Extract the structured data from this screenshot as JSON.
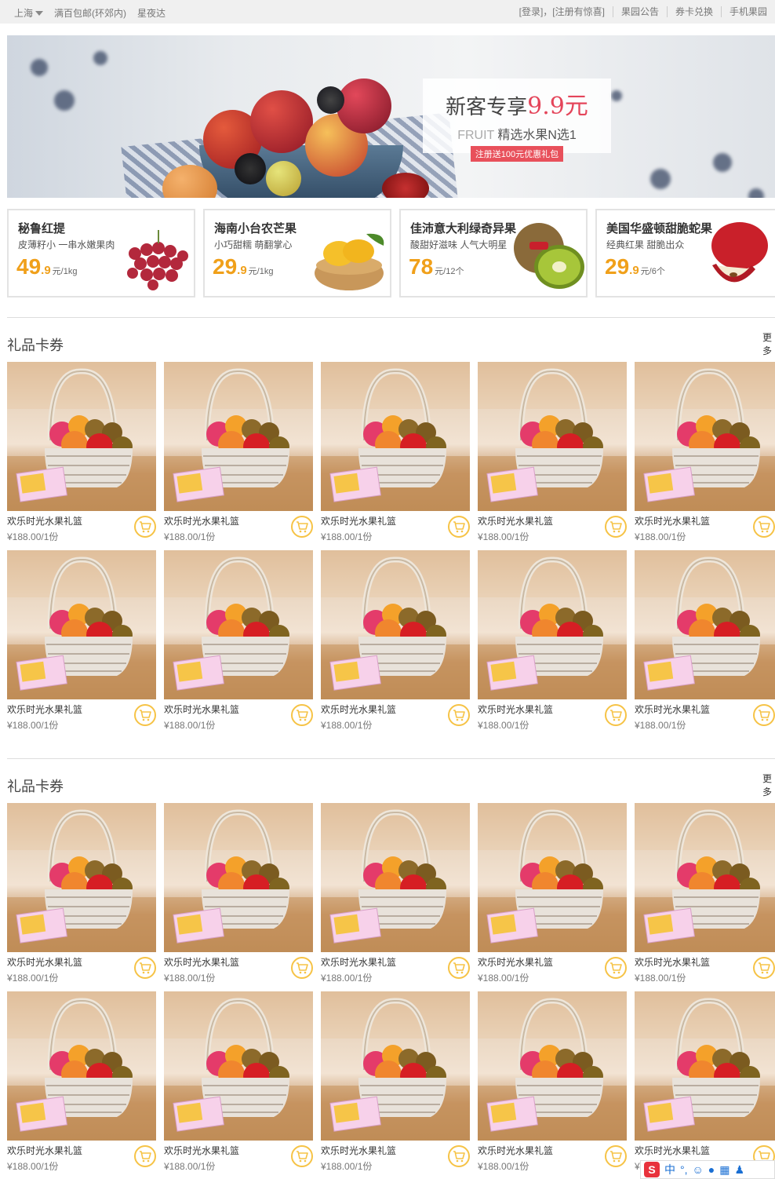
{
  "topbar": {
    "city": "上海",
    "links_left": [
      "满百包邮(环郊内)",
      "星夜达"
    ],
    "login": "[登录]，[注册有惊喜]",
    "links_right": [
      "果园公告",
      "券卡兑换",
      "手机果园"
    ]
  },
  "banner": {
    "headline": "新客专享",
    "price": "9.9元",
    "sub_en": "FRUIT",
    "sub_cn": "精选水果N选1",
    "tag": "注册送100元优惠礼包"
  },
  "features": [
    {
      "name": "秘鲁红提",
      "desc": "皮薄籽小 一串水嫩果肉",
      "price_int": "49",
      "price_dec": ".9",
      "unit": "元/1kg",
      "icon": "grapes-icon"
    },
    {
      "name": "海南小台农芒果",
      "desc": "小巧甜糯 萌翻掌心",
      "price_int": "29",
      "price_dec": ".9",
      "unit": "元/1kg",
      "icon": "mango-icon"
    },
    {
      "name": "佳沛意大利绿奇异果",
      "desc": "酸甜好滋味 人气大明星",
      "price_int": "78",
      "price_dec": "",
      "unit": "元/12个",
      "icon": "kiwi-icon"
    },
    {
      "name": "美国华盛顿甜脆蛇果",
      "desc": "经典红果 甜脆出众",
      "price_int": "29",
      "price_dec": ".9",
      "unit": "元/6个",
      "icon": "apple-icon"
    }
  ],
  "sections": [
    {
      "title": "礼品卡券",
      "more": "更多"
    },
    {
      "title": "礼品卡券",
      "more": "更多"
    }
  ],
  "product": {
    "name": "欢乐时光水果礼篮",
    "price": "¥188.00/1份"
  },
  "ime": {
    "label": "中"
  }
}
